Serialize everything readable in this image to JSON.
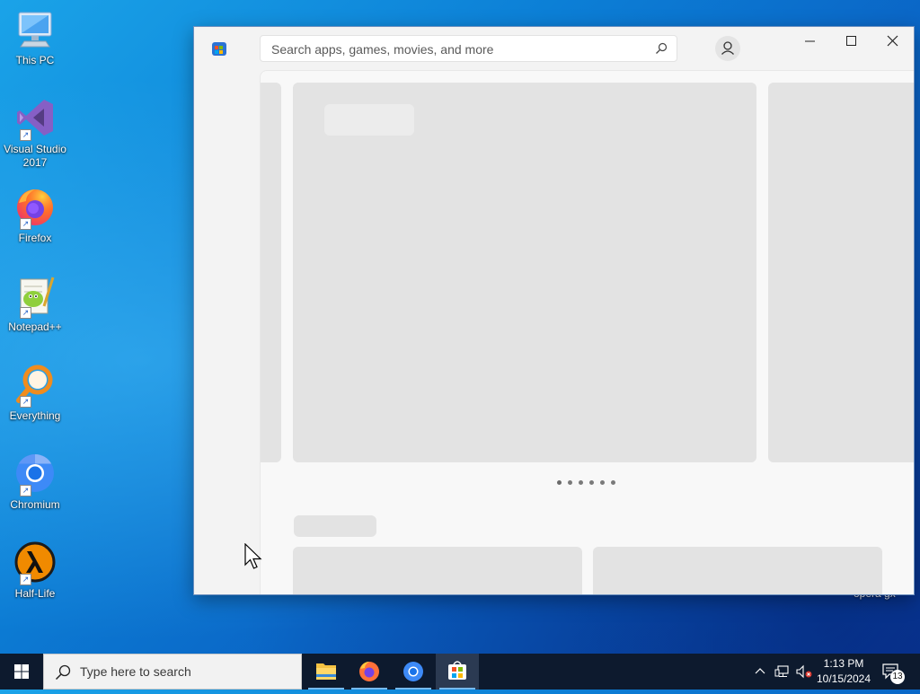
{
  "desktop": {
    "icons": [
      {
        "label": "This PC",
        "icon": "monitor-icon"
      },
      {
        "label": "Visual Studio 2017",
        "icon": "visual-studio-icon"
      },
      {
        "label": "Firefox",
        "icon": "firefox-icon"
      },
      {
        "label": "Notepad++",
        "icon": "notepad-plus-plus-icon"
      },
      {
        "label": "Everything",
        "icon": "everything-search-icon"
      },
      {
        "label": "Chromium",
        "icon": "chromium-icon"
      },
      {
        "label": "Half-Life",
        "icon": "half-life-icon"
      }
    ],
    "hidden_icon_label": "opera gx"
  },
  "store_window": {
    "search": {
      "placeholder": "Search apps, games, movies, and more"
    },
    "carousel": {
      "dot_count": 6,
      "active_index": 0
    }
  },
  "taskbar": {
    "search_placeholder": "Type here to search",
    "apps": [
      "file-explorer-icon",
      "firefox-icon",
      "chromium-icon",
      "microsoft-store-icon"
    ],
    "clock": {
      "time": "1:13 PM",
      "date": "10/15/2024"
    },
    "notifications_count": "13"
  },
  "colors": {
    "accent": "#0078d7",
    "taskbar": "#0d1a2e",
    "skeleton": "#e3e3e3"
  }
}
